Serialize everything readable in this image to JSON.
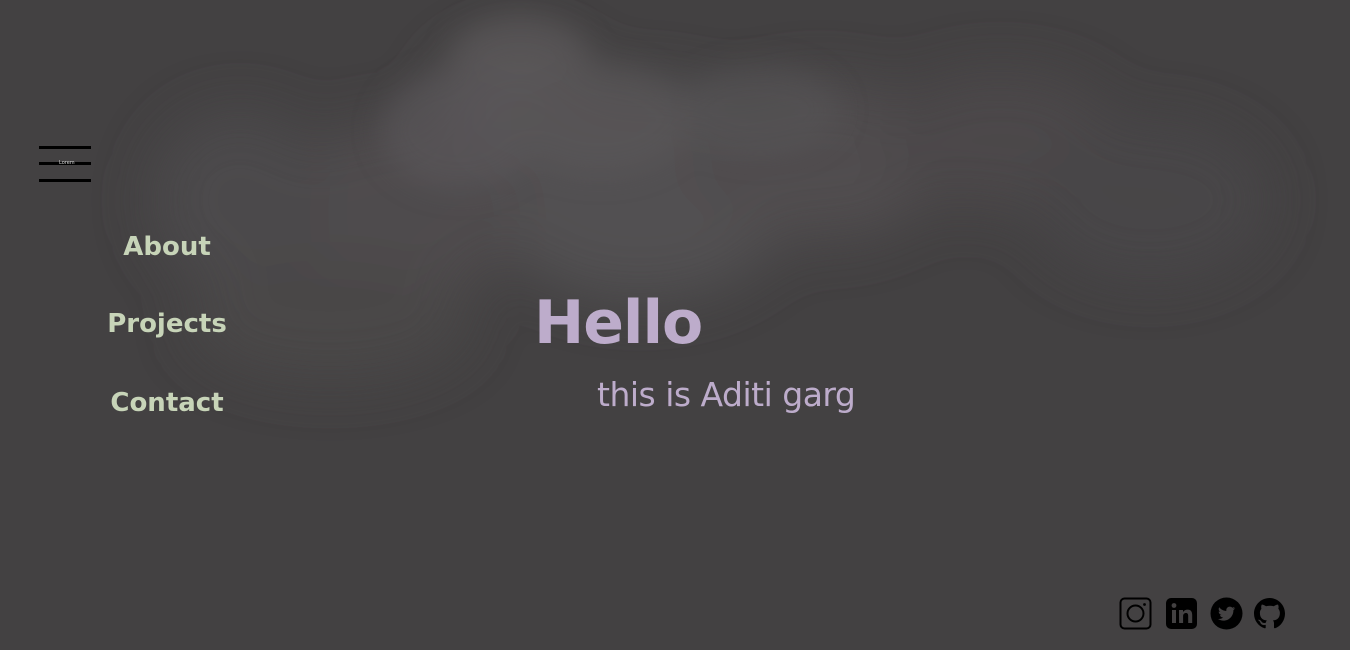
{
  "nav": {
    "items": [
      {
        "label": "About"
      },
      {
        "label": "Projects"
      },
      {
        "label": "Contact"
      }
    ]
  },
  "menu_toggle": {
    "icon": "hamburger-menu-icon",
    "tiny_label": "Lorem"
  },
  "hero": {
    "title": "Hello",
    "subtitle": "this is Aditi garg"
  },
  "social": {
    "icons": [
      "instagram-icon",
      "linkedin-icon",
      "twitter-icon",
      "github-icon"
    ]
  },
  "colors": {
    "background": "#434142",
    "nav_text": "#c7d4b8",
    "hero_text": "#bdaccb",
    "icon": "#000000"
  }
}
